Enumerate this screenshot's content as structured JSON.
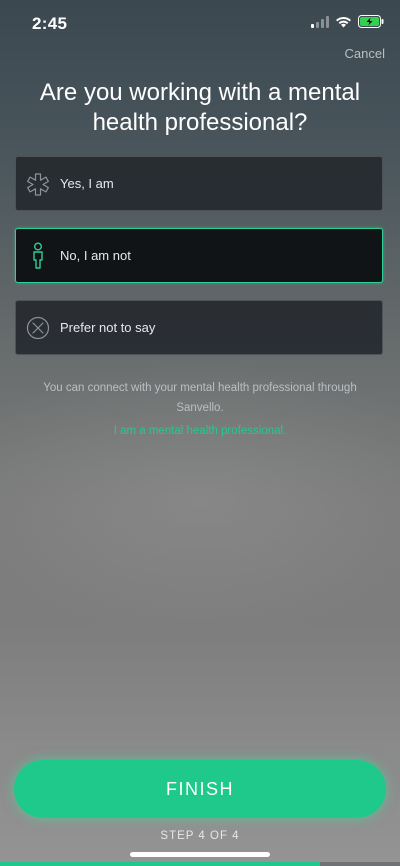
{
  "status_bar": {
    "time": "2:45",
    "icons": [
      "signal-icon",
      "wifi-icon",
      "battery-charging-icon"
    ]
  },
  "header": {
    "cancel_label": "Cancel",
    "title": "Are you working with a mental health professional?"
  },
  "options": [
    {
      "label": "Yes, I am",
      "icon": "medical-star-icon",
      "selected": false
    },
    {
      "label": "No, I am not",
      "icon": "person-icon",
      "selected": true
    },
    {
      "label": "Prefer not to say",
      "icon": "circle-x-icon",
      "selected": false
    }
  ],
  "info": {
    "text": "You can connect with your mental health professional through Sanvello.",
    "link": "I am a mental health professional."
  },
  "footer": {
    "finish_label": "FINISH",
    "step_text": "STEP 4 OF 4",
    "progress": 0.8
  },
  "colors": {
    "accent": "#1fc88b",
    "selected_border": "#2fce92",
    "link": "#27c88d"
  }
}
